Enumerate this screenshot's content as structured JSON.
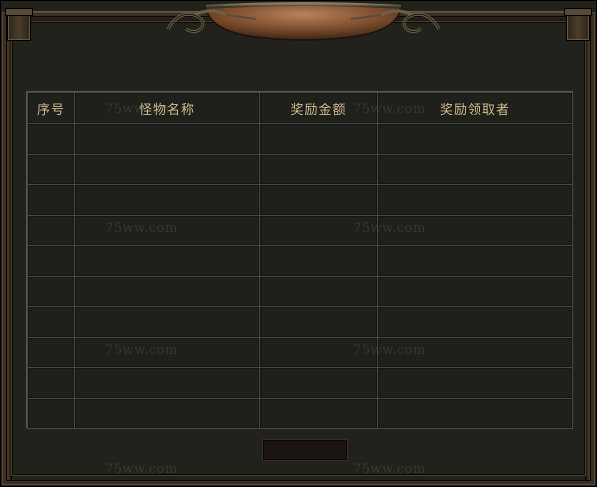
{
  "table": {
    "headers": [
      "序号",
      "怪物名称",
      "奖励金额",
      "奖励领取者"
    ],
    "rows": [
      [
        "",
        "",
        "",
        ""
      ],
      [
        "",
        "",
        "",
        ""
      ],
      [
        "",
        "",
        "",
        ""
      ],
      [
        "",
        "",
        "",
        ""
      ],
      [
        "",
        "",
        "",
        ""
      ],
      [
        "",
        "",
        "",
        ""
      ],
      [
        "",
        "",
        "",
        ""
      ],
      [
        "",
        "",
        "",
        ""
      ],
      [
        "",
        "",
        "",
        ""
      ],
      [
        "",
        "",
        "",
        ""
      ]
    ]
  },
  "watermark": "75ww.com",
  "colors": {
    "panel_bg": "#22221d",
    "frame": "#3a2f22",
    "header_text": "#d9c596",
    "grid_line": "#4a4a43"
  },
  "bottom_button": {
    "label": ""
  }
}
